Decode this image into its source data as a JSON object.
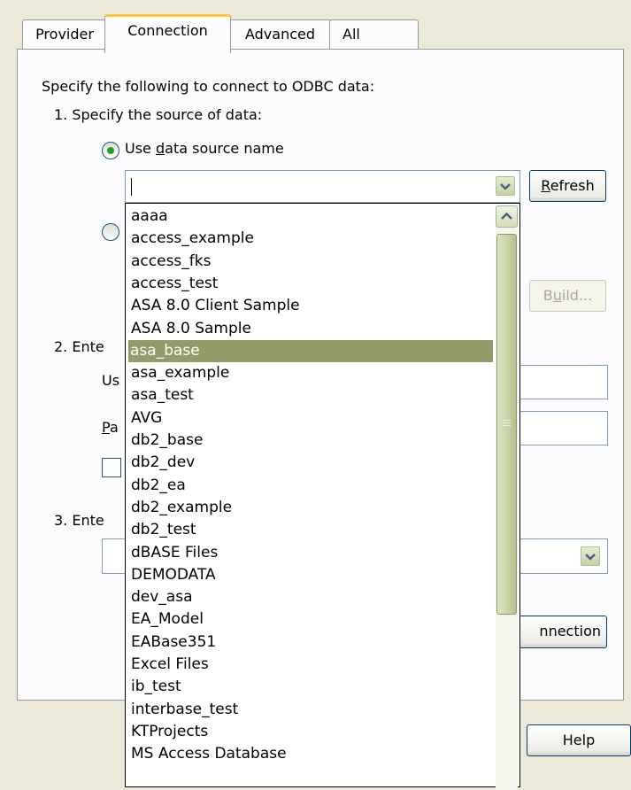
{
  "tabs": [
    {
      "label": "Provider",
      "active": false
    },
    {
      "label": "Connection",
      "active": true
    },
    {
      "label": "Advanced",
      "active": false
    },
    {
      "label": "All",
      "active": false
    }
  ],
  "connection": {
    "intro": "Specify the following to connect to ODBC data:",
    "step1_label": "1. Specify the source of data:",
    "radio_dsn": {
      "label_pre": "Use ",
      "label_accel": "d",
      "label_post": "ata source name",
      "checked": true
    },
    "dsn_value": "",
    "refresh": {
      "accel": "R",
      "rest": "efresh"
    },
    "build": {
      "pre": "B",
      "accel": "u",
      "post": "ild..."
    },
    "step2_prefix": "2. Ente",
    "user_prefix": "Us",
    "password_prefix": {
      "accel": "P",
      "rest": "a"
    },
    "step3_prefix": "3. Ente",
    "test_suffix": "nnection",
    "help": "Help"
  },
  "dropdown": {
    "selected_index": 6,
    "items": [
      "aaaa",
      "access_example",
      "access_fks",
      "access_test",
      "ASA 8.0 Client Sample",
      "ASA 8.0 Sample",
      "asa_base",
      "asa_example",
      "asa_test",
      "AVG",
      "db2_base",
      "db2_dev",
      "db2_ea",
      "db2_example",
      "db2_test",
      "dBASE Files",
      "DEMODATA",
      "dev_asa",
      "EA_Model",
      "EABase351",
      "Excel Files",
      "ib_test",
      "interbase_test",
      "KTProjects",
      "MS Access Database"
    ]
  },
  "icons": {
    "combo_arrow": "chevron-down-icon",
    "scroll_up": "chevron-up-icon",
    "scroll_grip": "grip-icon"
  }
}
